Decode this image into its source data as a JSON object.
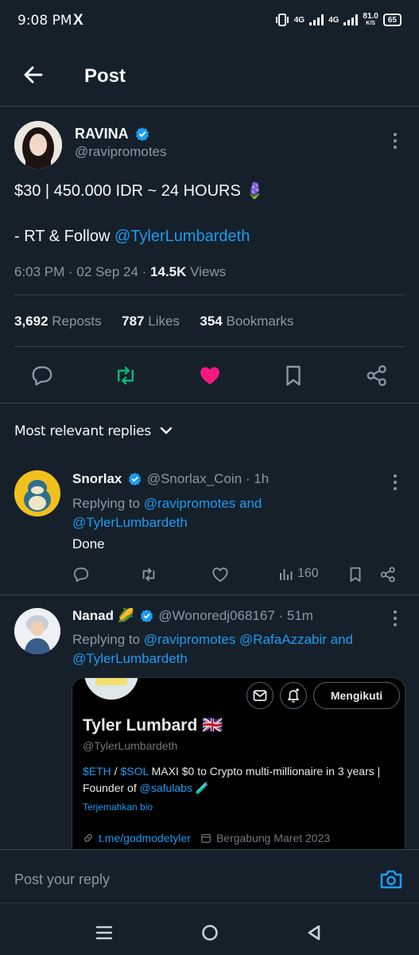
{
  "status_bar": {
    "time": "9:08 PM",
    "x_icon": "X",
    "net1": "4G",
    "net2": "4G",
    "speed_value": "81.0",
    "speed_unit": "K/S",
    "battery": "65"
  },
  "header": {
    "title": "Post"
  },
  "post": {
    "author_name": "RAVINA",
    "author_handle": "@ravipromotes",
    "line1": "$30 | 450.000 IDR ~ 24 HOURS",
    "line1_emoji": "🪻",
    "line2_prefix": "- RT & Follow ",
    "line2_mention": "@TylerLumbardeth",
    "meta_time": "6:03 PM · 02 Sep 24 · ",
    "views_count": "14.5K",
    "views_label": " Views",
    "reposts_count": "3,692",
    "reposts_label": "Reposts",
    "likes_count": "787",
    "likes_label": "Likes",
    "bookmarks_count": "354",
    "bookmarks_label": "Bookmarks"
  },
  "replies_header": {
    "label": "Most relevant replies"
  },
  "replies": [
    {
      "name": "Snorlax",
      "handle": "@Snorlax_Coin",
      "time": "· 1h",
      "replying_prefix": "Replying to ",
      "replying_1": "@ravipromotes",
      "replying_and": " and",
      "replying_2": "@TylerLumbardeth",
      "text": "Done",
      "views": "160"
    },
    {
      "name": "Nanad",
      "name_emoji": "🌽",
      "handle": "@Wonoredj068167",
      "time": "· 51m",
      "replying_prefix": "Replying to ",
      "replying_1": "@ravipromotes",
      "replying_2": "@RafaAzzabir",
      "replying_and": " and",
      "replying_3": "@TylerLumbardeth"
    }
  ],
  "embed": {
    "follow_label": "Mengikuti",
    "name": "Tyler Lumbard",
    "name_flag": "🇬🇧",
    "handle": "@TylerLumbardeth",
    "bio_eth": "$ETH",
    "bio_sep": " / ",
    "bio_sol": "$SOL",
    "bio_rest": " MAXI $0 to Crypto multi-millionaire in 3 years | Founder of ",
    "bio_mention": "@safulabs",
    "bio_emoji": "🧪",
    "translate": "Terjemahkan bio",
    "link": "t.me/godmodetyler",
    "joined": "Bergabung Maret 2023"
  },
  "reply_bar": {
    "placeholder": "Post your reply"
  },
  "colors": {
    "background": "#15202b",
    "accent": "#1d9bf0",
    "like": "#f91880",
    "repost": "#00ba7c",
    "muted": "#8b98a5"
  }
}
